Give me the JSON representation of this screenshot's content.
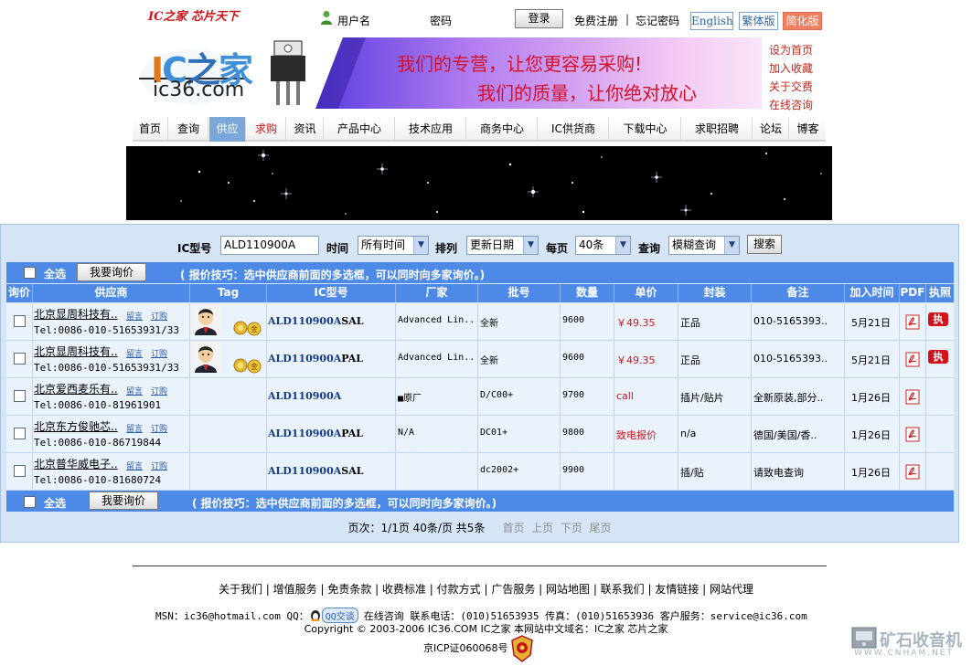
{
  "topbar": {
    "slogan": "IC之家 芯片天下",
    "username_label": "用户名",
    "password_label": "密码",
    "login_button": "登录",
    "register": "免费注册",
    "separator": "|",
    "forgot": "忘记密码",
    "lang_en": "English",
    "lang_tw": "繁体版",
    "lang_cn": "简化版"
  },
  "logo": {
    "mark": "IC之家",
    "domain": "ic36.com"
  },
  "banner": {
    "line1": "我们的专营，让您更容易采购!",
    "line2": "我们的质量，让你绝对放心"
  },
  "right_links": [
    "设为首页",
    "加入收藏",
    "关于交费",
    "在线咨询"
  ],
  "nav": {
    "items": [
      "首页",
      "查询",
      "供应",
      "求购",
      "资讯",
      "产品中心",
      "技术应用",
      "商务中心",
      "IC供货商",
      "下载中心",
      "求职招聘",
      "论坛",
      "博客"
    ],
    "active": "供应",
    "highlight": "求购"
  },
  "search": {
    "ic_label": "IC型号",
    "ic_value": "ALD110900A",
    "time_label": "时间",
    "time_value": "所有时间",
    "sort_label": "排列",
    "sort_value": "更新日期",
    "perpage_label": "每页",
    "perpage_value": "40条",
    "query_label": "查询",
    "query_value": "模糊查询",
    "search_button": "搜索"
  },
  "actionbar": {
    "select_all": "全选",
    "inquiry_button": "我要询价",
    "tip": "( 报价技巧：选中供应商前面的多选框，可以同时向多家询价。)"
  },
  "table": {
    "headers": [
      "询价",
      "供应商",
      "Tag",
      "IC型号",
      "厂家",
      "批号",
      "数量",
      "单价",
      "封装",
      "备注",
      "加入时间",
      "PDF",
      "执照"
    ],
    "rows": [
      {
        "supplier": "北京显周科技有..",
        "msg": "留言",
        "order": "订购",
        "tel": "Tel:0086-010-51653931/33",
        "part_main": "ALD110900A",
        "part_suffix": "SAL",
        "maker": "Advanced Lin..",
        "batch": "全新",
        "qty": "9600",
        "price": "￥49.35",
        "pkg": "正品",
        "note": "010-5165393..",
        "date": "5月21日",
        "exec": "执"
      },
      {
        "supplier": "北京显周科技有..",
        "msg": "留言",
        "order": "订购",
        "tel": "Tel:0086-010-51653931/33",
        "part_main": "ALD110900A",
        "part_suffix": "PAL",
        "maker": "Advanced Lin..",
        "batch": "全新",
        "qty": "9600",
        "price": "￥49.35",
        "pkg": "正品",
        "note": "010-5165393..",
        "date": "5月21日",
        "exec": "执"
      },
      {
        "supplier": "北京爱西麦乐有..",
        "msg": "留言",
        "order": "订购",
        "tel": "Tel:0086-010-81961901",
        "part_main": "ALD110900A",
        "part_suffix": "",
        "maker": "■原厂",
        "batch": "D/C00+",
        "qty": "9700",
        "price": "call",
        "pkg": "插片/贴片",
        "note": "全新原装,部分..",
        "date": "1月26日",
        "exec": ""
      },
      {
        "supplier": "北京东方俊驰芯..",
        "msg": "留言",
        "order": "订购",
        "tel": "Tel:0086-010-86719844",
        "part_main": "ALD110900A",
        "part_suffix": "PAL",
        "maker": "N/A",
        "batch": "DC01+",
        "qty": "9800",
        "price": "致电报价",
        "pkg": "n/a",
        "note": "德国/美国/香..",
        "date": "1月26日",
        "exec": ""
      },
      {
        "supplier": "北京普华威电子..",
        "msg": "留言",
        "order": "订购",
        "tel": "Tel:0086-010-81680724",
        "part_main": "ALD110900A",
        "part_suffix": "SAL",
        "maker": "",
        "batch": "dc2002+",
        "qty": "9900",
        "price": "",
        "pkg": "插/贴",
        "note": "请致电查询",
        "date": "1月26日",
        "exec": ""
      }
    ]
  },
  "pager": {
    "info": "页次：1/1页 40条/页 共5条",
    "first": "首页",
    "prev": "上页",
    "next": "下页",
    "last": "尾页"
  },
  "footer": {
    "links": "关于我们 | 增值服务 | 免责条款 | 收费标准 | 付款方式 | 广告服务 | 网站地图 | 联系我们 | 友情链接 | 网站代理",
    "msn": "MSN：ic36@hotmail.com  QQ：",
    "qq_badge": "QQ交谈",
    "contact": "在线咨询  联系电话：(010)51653935 传真：(010)51653936 客户服务：service@ic36.com",
    "copyright": "Copyright © 2003-2006 IC36.COM IC之家 本网站中文域名：IC之家 芯片之家",
    "icp": "京ICP证060068号"
  },
  "watermark": {
    "title": "矿石收音机",
    "url": "WWW.CNHAM.NET"
  },
  "colors": {
    "accent_blue": "#4d8ae8",
    "panel_bg": "#d6e5f6",
    "price_red": "#d0141a",
    "nav_active": "#7aa6d8"
  }
}
